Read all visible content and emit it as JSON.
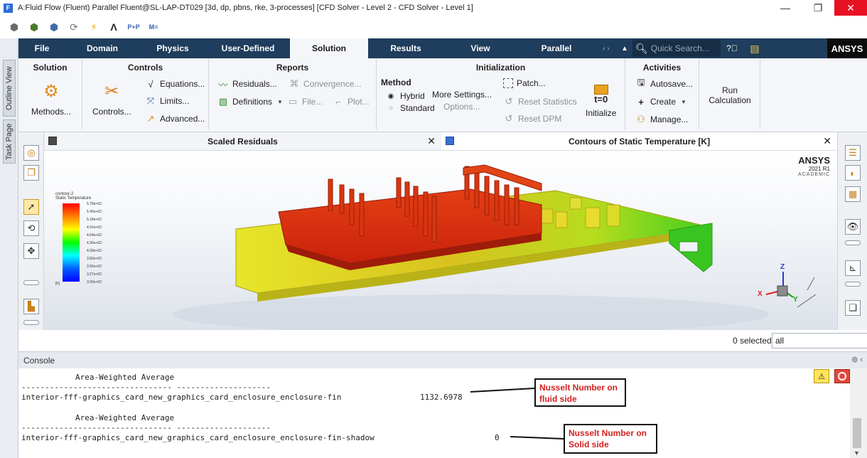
{
  "window": {
    "title": "A:Fluid Flow (Fluent) Parallel Fluent@SL-LAP-DT029  [3d, dp, pbns, rke, 3-processes] [CFD Solver - Level 2 - CFD Solver - Level 1]",
    "app_icon": "F",
    "minimize": "—",
    "maximize": "❐",
    "close": "✕"
  },
  "side_tabs": [
    "Outline View",
    "Task Page"
  ],
  "ribbon_tabs": [
    {
      "label": "File"
    },
    {
      "label": "Domain"
    },
    {
      "label": "Physics"
    },
    {
      "label": "User-Defined"
    },
    {
      "label": "Solution"
    },
    {
      "label": "Results"
    },
    {
      "label": "View"
    },
    {
      "label": "Parallel"
    }
  ],
  "active_tab": "Solution",
  "quick_search_placeholder": "Quick Search...",
  "brand": "ANSYS",
  "ribbon": {
    "solution": {
      "title": "Solution",
      "methods": "Methods..."
    },
    "controls": {
      "title": "Controls",
      "controls": "Controls...",
      "equations": "Equations...",
      "limits": "Limits...",
      "advanced": "Advanced..."
    },
    "reports": {
      "title": "Reports",
      "residuals": "Residuals...",
      "convergence": "Convergence...",
      "definitions": "Definitions",
      "file": "File...",
      "plot": "Plot..."
    },
    "initialization": {
      "title": "Initialization",
      "method_label": "Method",
      "hybrid": "Hybrid",
      "standard": "Standard",
      "more_settings": "More Settings...",
      "options": "Options...",
      "patch": "Patch...",
      "reset_statistics": "Reset Statistics",
      "reset_dpm": "Reset DPM",
      "initialize": "Initialize",
      "t0_icon": "t=0"
    },
    "activities": {
      "title": "Activities",
      "autosave": "Autosave...",
      "create": "Create",
      "manage": "Manage..."
    },
    "run": {
      "label": "Run Calculation"
    }
  },
  "panes": {
    "left": {
      "title": "Scaled Residuals"
    },
    "right": {
      "title": "Contours of Static Temperature [K]"
    }
  },
  "watermark": {
    "line1": "ANSYS",
    "line2": "2021 R1",
    "line3": "ACADEMIC"
  },
  "legend": {
    "name": "contour-2",
    "quantity": "Static Temperature",
    "ticks": [
      "5.78e+02",
      "5.45e+02",
      "5.18e+02",
      "4.91e+02",
      "4.64e+02",
      "4.36e+02",
      "4.09e+02",
      "3.82e+02",
      "3.55e+02",
      "3.27e+02",
      "3.00e+02"
    ],
    "unit": "[K]"
  },
  "axes": {
    "x": "X",
    "y": "Y",
    "z": "Z"
  },
  "selection": {
    "count": "0 selected",
    "filter": "all"
  },
  "console": {
    "title": "Console",
    "header1": "Area-Weighted Average",
    "sep1": "-------------------------------- --------------------",
    "row1_name": "interior-fff-graphics_card_new_graphics_card_enclosure_enclosure-fin",
    "row1_value": "1132.6978",
    "header2": "Area-Weighted Average",
    "sep2": "-------------------------------- --------------------",
    "row2_name": "interior-fff-graphics_card_new_graphics_card_enclosure_enclosure-fin-shadow",
    "row2_value": "0"
  },
  "annotations": [
    {
      "line1": "Nusselt Number on",
      "line2": "fluid side"
    },
    {
      "line1": "Nusselt Number on",
      "line2": "Solid side"
    }
  ],
  "colors": {
    "ribbon_tab_bg": "#1f3d5c",
    "annotation_text": "#d32020",
    "close_btn": "#e81123"
  }
}
